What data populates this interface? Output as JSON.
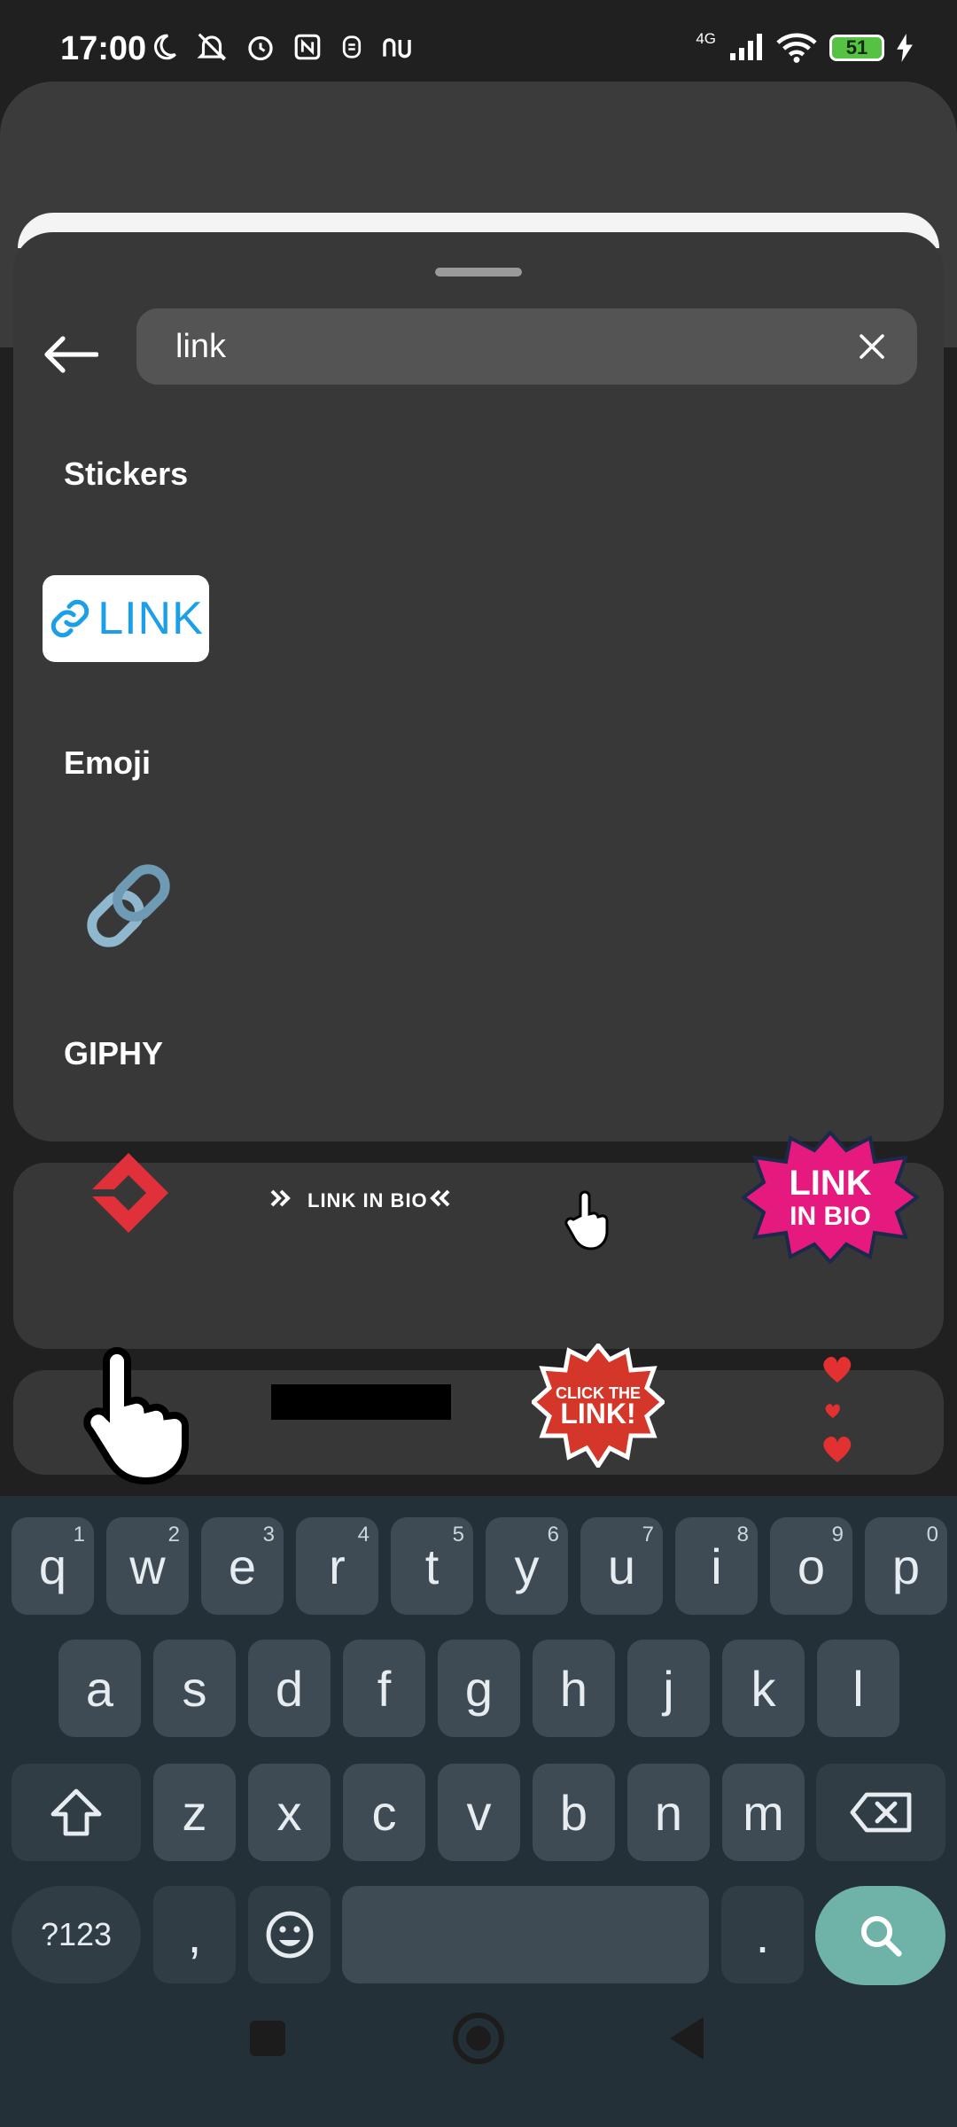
{
  "status": {
    "time": "17:00",
    "network": "4G",
    "battery": "51"
  },
  "search": {
    "query": "link"
  },
  "sections": {
    "stickers": "Stickers",
    "emoji": "Emoji",
    "giphy": "GIPHY"
  },
  "sticker": {
    "link_label": "LINK"
  },
  "giphy": {
    "link_in_bio_banner": "LINK IN BIO",
    "badge_line1": "LINK",
    "badge_line2": "IN BIO",
    "click_line1": "CLICK THE",
    "click_line2": "LINK!"
  },
  "keyboard": {
    "row1": [
      {
        "key": "q",
        "hint": "1"
      },
      {
        "key": "w",
        "hint": "2"
      },
      {
        "key": "e",
        "hint": "3"
      },
      {
        "key": "r",
        "hint": "4"
      },
      {
        "key": "t",
        "hint": "5"
      },
      {
        "key": "y",
        "hint": "6"
      },
      {
        "key": "u",
        "hint": "7"
      },
      {
        "key": "i",
        "hint": "8"
      },
      {
        "key": "o",
        "hint": "9"
      },
      {
        "key": "p",
        "hint": "0"
      }
    ],
    "row2": [
      "a",
      "s",
      "d",
      "f",
      "g",
      "h",
      "j",
      "k",
      "l"
    ],
    "row3": [
      "z",
      "x",
      "c",
      "v",
      "b",
      "n",
      "m"
    ],
    "symbols_label": "?123",
    "comma": ",",
    "period": "."
  },
  "colors": {
    "accent_search": "#6fb3a8",
    "link_blue": "#1a9fe8",
    "badge_pink": "#e5197e",
    "badge_red": "#d4372a"
  },
  "icons": [
    "back-arrow-icon",
    "clear-icon",
    "search-icon",
    "shift-icon",
    "backspace-icon",
    "emoji-icon",
    "chain-link-icon",
    "hand-cursor-icon"
  ]
}
